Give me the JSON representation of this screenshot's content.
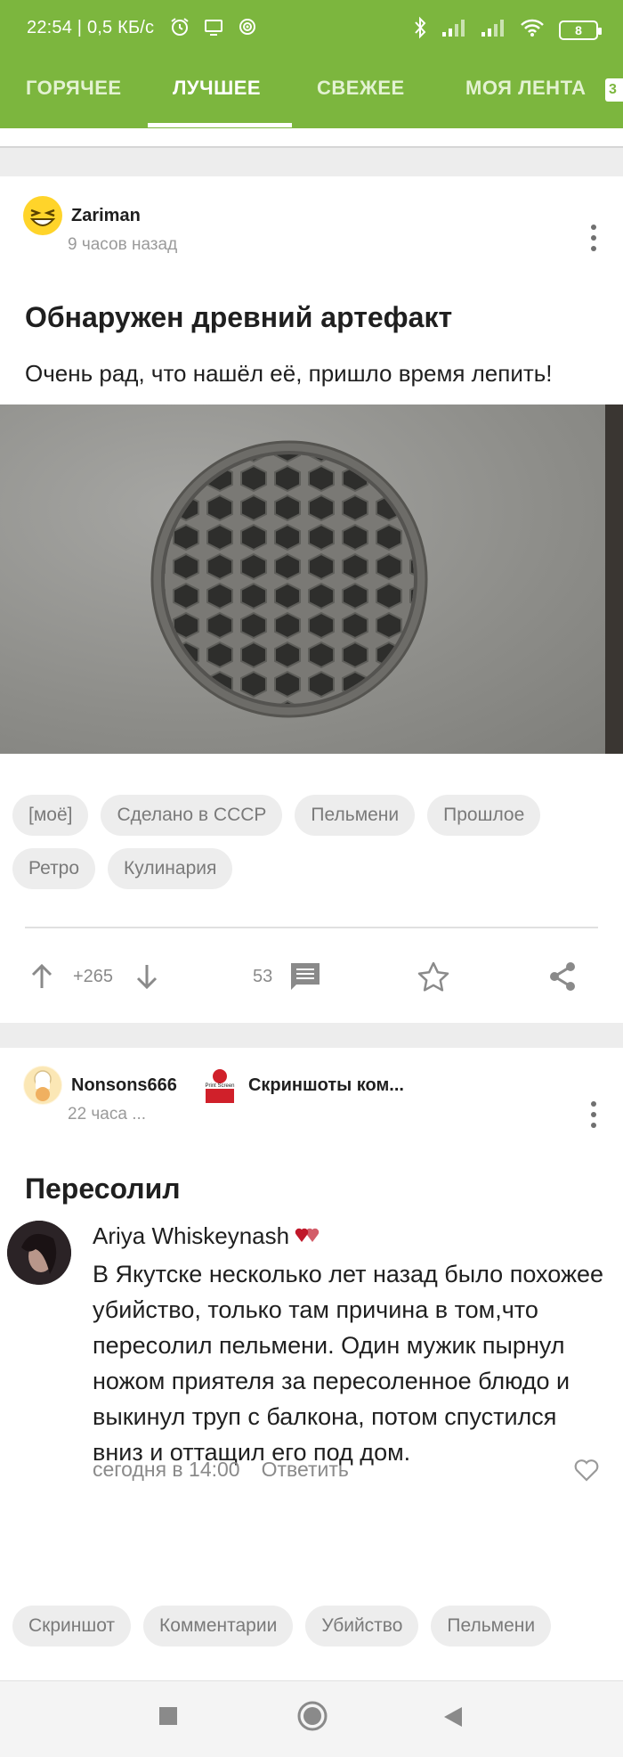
{
  "status_bar": {
    "time_text": "22:54 | 0,5 КБ/с",
    "battery_level": "8",
    "icons": [
      "alarm-icon",
      "cast-icon",
      "focus-icon",
      "bluetooth-icon",
      "signal-icon",
      "wifi-icon",
      "battery-icon"
    ]
  },
  "tabs": [
    {
      "label": "ГОРЯЧЕЕ",
      "active": false
    },
    {
      "label": "ЛУЧШЕЕ",
      "active": true
    },
    {
      "label": "СВЕЖЕЕ",
      "active": false
    },
    {
      "label": "МОЯ ЛЕНТА",
      "active": false
    }
  ],
  "tab_badge": "3",
  "post1": {
    "author": "Zariman",
    "time": "9 часов назад",
    "title": "Обнаружен древний артефакт",
    "text": "Очень рад, что нашёл её, пришло время лепить!",
    "tags": [
      "[моё]",
      "Сделано в СССР",
      "Пельмени",
      "Прошлое",
      "Ретро",
      "Кулинария"
    ],
    "rating": "+265",
    "comments": "53"
  },
  "post2": {
    "author": "Nonsons666",
    "community": "Скриншоты ком...",
    "community_avatar_text": "Print Screen",
    "time": "22 часа ...",
    "title": "Пересолил",
    "comment": {
      "name": "Ariya Whiskeynash",
      "text": "В Якутске несколько лет назад было похожее убийство, только там причина в том,что пересолил пельмени. Один мужик пырнул ножом приятеля за пересоленное блюдо и выкинул труп с балкона, потом спустился вниз и оттащил его под дом.",
      "time": "сегодня в 14:00",
      "reply": "Ответить"
    },
    "tags": [
      "Скриншот",
      "Комментарии",
      "Убийство",
      "Пельмени"
    ]
  },
  "colors": {
    "accent": "#7cb63e",
    "text": "#1f1f1f",
    "muted": "#8a8a8a"
  }
}
